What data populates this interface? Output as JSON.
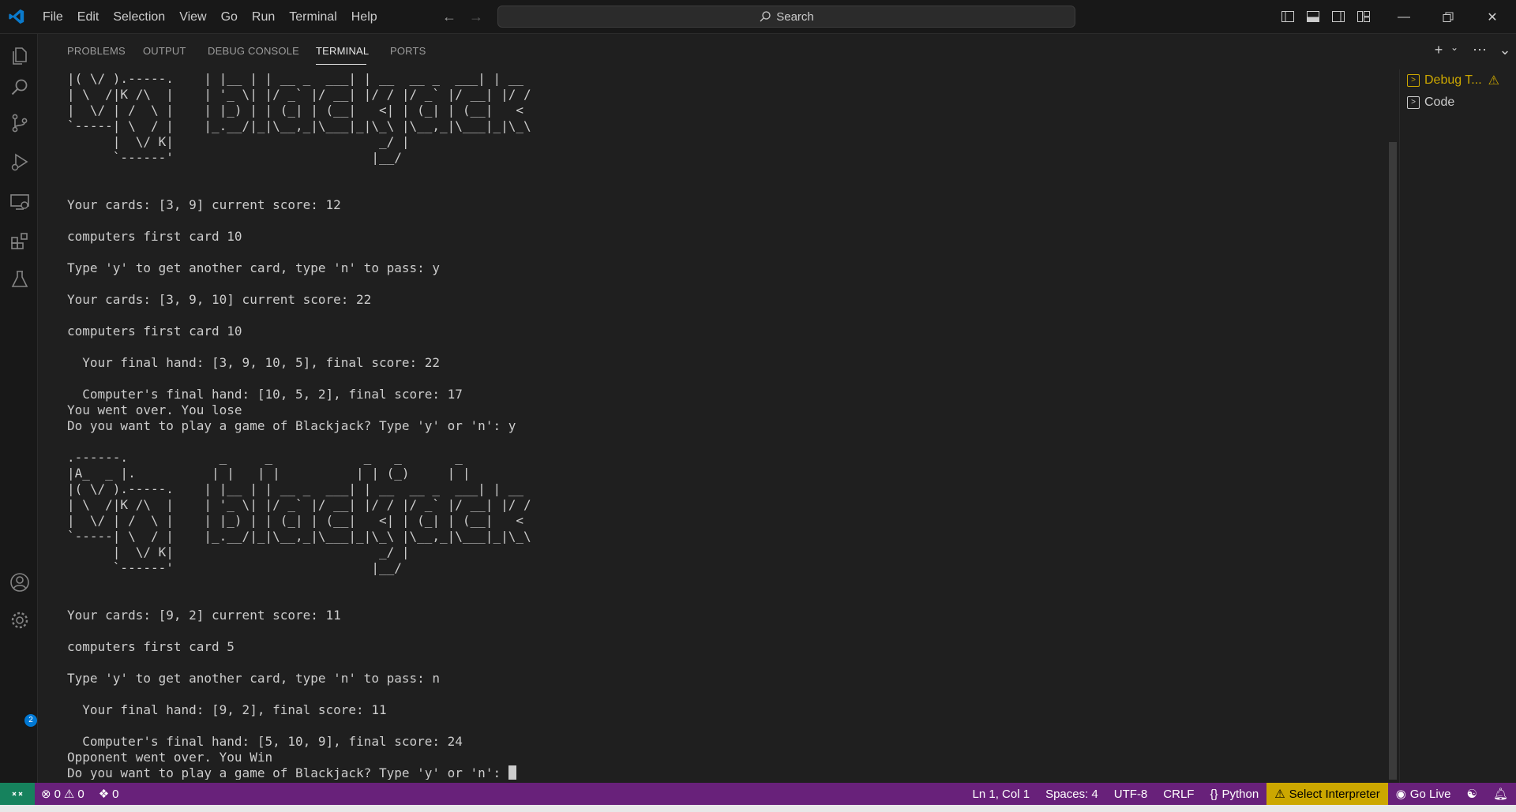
{
  "titlebar": {
    "menu": [
      "File",
      "Edit",
      "Selection",
      "View",
      "Go",
      "Run",
      "Terminal",
      "Help"
    ],
    "search_label": "Search"
  },
  "activity_bar": {
    "items": [
      "explorer-icon",
      "search-icon",
      "source-control-icon",
      "run-debug-icon",
      "remote-explorer-icon",
      "extensions-icon",
      "testing-icon"
    ],
    "accounts_badge": "2"
  },
  "panel": {
    "tabs": [
      "PROBLEMS",
      "OUTPUT",
      "DEBUG CONSOLE",
      "TERMINAL",
      "PORTS"
    ],
    "active_tab": "TERMINAL"
  },
  "terminal": {
    "lines": [
      "|( \\/ ).-----.    | |__ | | __ _  ___| | __  __ _  ___| | __",
      "| \\  /|K /\\  |    | '_ \\| |/ _` |/ __| |/ / |/ _` |/ __| |/ /",
      "|  \\/ | /  \\ |    | |_) | | (_| | (__|   <| | (_| | (__|   < ",
      "`-----| \\  / |    |_.__/|_|\\__,_|\\___|_|\\_\\ |\\__,_|\\___|_|\\_\\",
      "      |  \\/ K|                           _/ |                ",
      "      `------'                          |__/                 ",
      "",
      "",
      "Your cards: [3, 9] current score: 12",
      "",
      "computers first card 10",
      "",
      "Type 'y' to get another card, type 'n' to pass: y",
      "",
      "Your cards: [3, 9, 10] current score: 22",
      "",
      "computers first card 10",
      "",
      "  Your final hand: [3, 9, 10, 5], final score: 22",
      "",
      "  Computer's final hand: [10, 5, 2], final score: 17",
      "You went over. You lose",
      "Do you want to play a game of Blackjack? Type 'y' or 'n': y",
      "",
      ".------.            _     _            _   _       _",
      "|A_  _ |.          | |   | |          | | (_)     | |",
      "|( \\/ ).-----.    | |__ | | __ _  ___| | __  __ _  ___| | __",
      "| \\  /|K /\\  |    | '_ \\| |/ _` |/ __| |/ / |/ _` |/ __| |/ /",
      "|  \\/ | /  \\ |    | |_) | | (_| | (__|   <| | (_| | (__|   < ",
      "`-----| \\  / |    |_.__/|_|\\__,_|\\___|_|\\_\\ |\\__,_|\\___|_|\\_\\",
      "      |  \\/ K|                           _/ |                ",
      "      `------'                          |__/                 ",
      "",
      "",
      "Your cards: [9, 2] current score: 11",
      "",
      "computers first card 5",
      "",
      "Type 'y' to get another card, type 'n' to pass: n",
      "",
      "  Your final hand: [9, 2], final score: 11",
      "",
      "  Computer's final hand: [5, 10, 9], final score: 24",
      "Opponent went over. You Win"
    ],
    "prompt": "Do you want to play a game of Blackjack? Type 'y' or 'n': "
  },
  "terminal_list": {
    "items": [
      {
        "label": "Debug T...",
        "warning": true
      },
      {
        "label": "Code",
        "warning": false
      }
    ]
  },
  "statusbar": {
    "errors": "0",
    "warnings": "0",
    "ports": "0",
    "position": "Ln 1, Col 1",
    "spaces": "Spaces: 4",
    "encoding": "UTF-8",
    "eol": "CRLF",
    "language": "Python",
    "interpreter": "Select Interpreter",
    "go_live": "Go Live"
  },
  "colors": {
    "statusbar": "#68217a",
    "remote": "#16825d",
    "warning": "#cca700",
    "accent": "#0078d4"
  }
}
